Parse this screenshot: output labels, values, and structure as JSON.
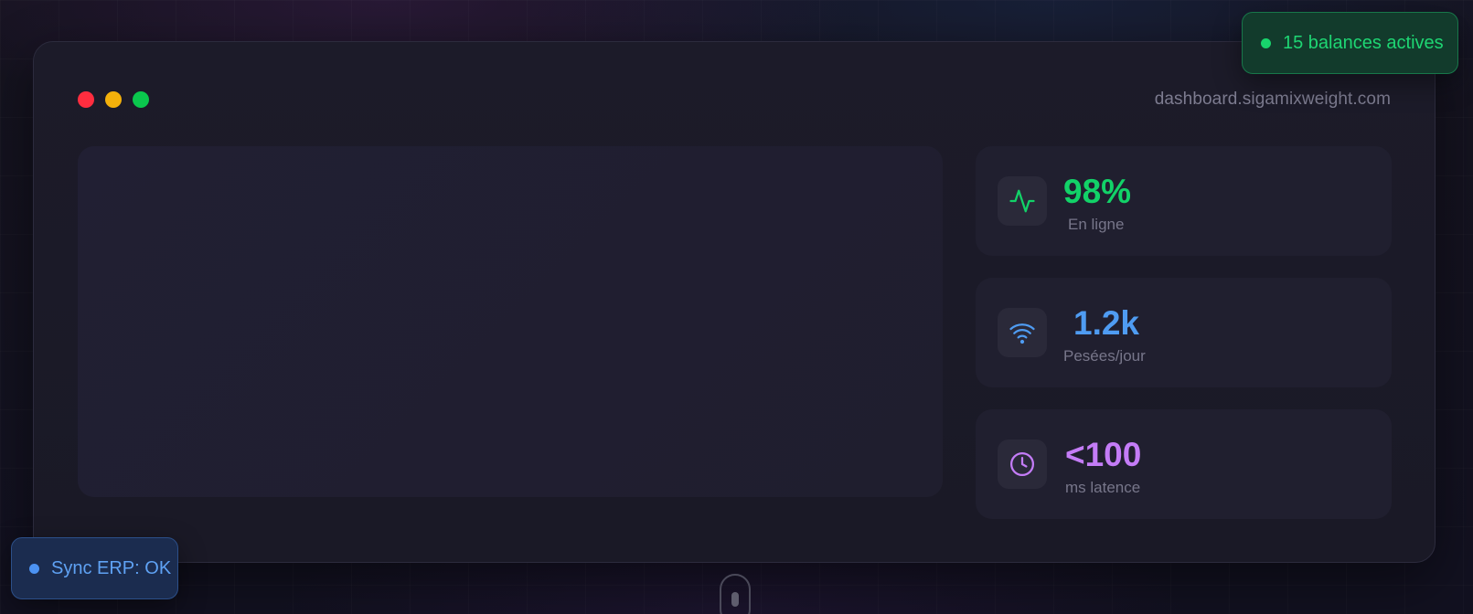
{
  "window": {
    "url": "dashboard.sigamixweight.com"
  },
  "stats": [
    {
      "value": "98%",
      "label": "En ligne",
      "icon": "activity-icon",
      "color": "#12d268"
    },
    {
      "value": "1.2k",
      "label": "Pesées/jour",
      "icon": "wifi-icon",
      "color": "#4f9cf2"
    },
    {
      "value": "<100",
      "label": "ms latence",
      "icon": "clock-icon",
      "color": "#c47cf7"
    }
  ],
  "badges": {
    "top": {
      "text": "15 balances actives",
      "color": "#1ed673"
    },
    "bottom": {
      "text": "Sync ERP: OK",
      "color": "#5fa2f4"
    }
  },
  "colors": {
    "close": "#ff2d3f",
    "minimize": "#f4b10b",
    "maximize": "#0ac74d"
  }
}
